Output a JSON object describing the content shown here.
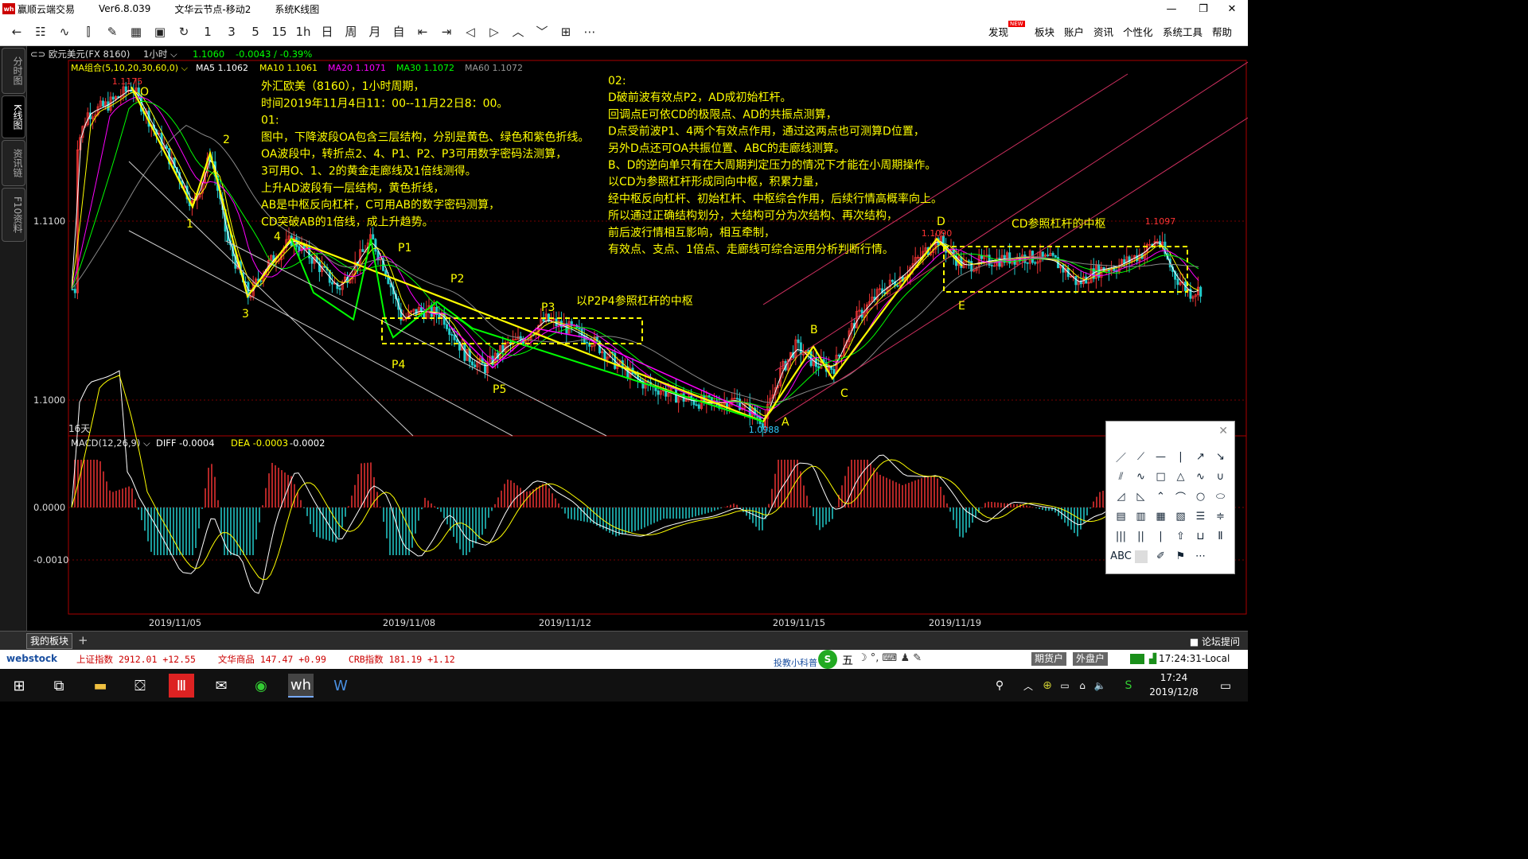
{
  "window": {
    "app": "赢顺云端交易",
    "version": "Ver6.8.039",
    "node": "文华云节点-移动2",
    "view": "系统K线图",
    "logo": "wh"
  },
  "toolbar": {
    "icons": [
      "back-icon",
      "table-icon",
      "line-chart-icon",
      "bar-icon",
      "draw-icon",
      "grid-icon",
      "save-icon",
      "refresh-icon"
    ],
    "periods": [
      "1",
      "3",
      "5",
      "15",
      "1h",
      "日",
      "周",
      "月",
      "自"
    ],
    "menu": [
      "发现",
      "板块",
      "账户",
      "资讯",
      "个性化",
      "系统工具",
      "帮助"
    ],
    "new_badge": "NEW"
  },
  "rail": [
    "分时图",
    "K线图",
    "资讯链",
    "F10资料"
  ],
  "chart": {
    "symbol": "欧元美元(FX 8160)",
    "period": "1小时",
    "last": "1.1060",
    "change": "-0.0043 / -0.39%",
    "ma_label": "MA组合(5,10,20,30,60,0)",
    "ma": [
      {
        "t": "MA5 1.1062",
        "c": "#ffffff"
      },
      {
        "t": "MA10 1.1061",
        "c": "#ffff00"
      },
      {
        "t": "MA20 1.1071",
        "c": "#ff00ff"
      },
      {
        "t": "MA30 1.1072",
        "c": "#00ff00"
      },
      {
        "t": "MA60 1.1072",
        "c": "#999999"
      }
    ],
    "yticks": [
      "1.1100",
      "1.1000"
    ],
    "high_label": "1.1175",
    "low_label": "1.0988",
    "d_label": "1.1090",
    "peak_label": "1.1097",
    "days": "16天",
    "macd_label": "MACD(12,26,9)",
    "diff": "DIFF -0.0004",
    "dea": "DEA -0.0003",
    "macd": "-0.0002",
    "macd_ticks": [
      "0.0000",
      "-0.0010"
    ],
    "dates": [
      "2019/11/05",
      "2019/11/08",
      "2019/11/12",
      "2019/11/15",
      "2019/11/19"
    ],
    "points": [
      "O",
      "1",
      "2",
      "3",
      "4",
      "P1",
      "P2",
      "P3",
      "P4",
      "P5",
      "A",
      "B",
      "C",
      "D",
      "E"
    ],
    "box1": "以P2P4参照杠杆的中枢",
    "box2": "CD参照杠杆的中枢",
    "note1": [
      "外汇欧美（8160），1小时周期，",
      "时间2019年11月4日11：00--11月22日8：00。",
      "01:",
      "图中，下降波段OA包含三层结构，分别是黄色、绿色和紫色折线。",
      "OA波段中，转折点2、4、P1、P2、P3可用数字密码法测算，",
      "3可用O、1、2的黄金走廊线及1倍线测得。",
      "上升AD波段有一层结构，黄色折线，",
      "AB是中枢反向杠杆，C可用AB的数字密码测算，",
      "CD突破AB的1倍线，成上升趋势。"
    ],
    "note2": [
      "02:",
      "D破前波有效点P2，AD成初始杠杆。",
      "回调点E可依CD的极限点、AD的共振点测算，",
      "D点受前波P1、4两个有效点作用，通过这两点也可测算D位置，",
      "另外D点还可OA共振位置、ABC的走廊线测算。",
      "B、D的逆向单只有在大周期判定压力的情况下才能在小周期操作。",
      "以CD为参照杠杆形成同向中枢，积累力量，",
      "经中枢反向杠杆、初始杠杆、中枢综合作用，后续行情高概率向上。",
      "所以通过正确结构划分，大结构可分为次结构、再次结构，",
      "前后波行情相互影响，相互牵制，",
      "有效点、支点、1倍点、走廊线可综合运用分析判断行情。"
    ]
  },
  "bottom": {
    "tab": "我的板块",
    "add": "+",
    "forum": "论坛提问"
  },
  "status": {
    "brand": "webstock",
    "idx": [
      {
        "n": "上证指数",
        "v": "2912.01",
        "c": "+12.55"
      },
      {
        "n": "文华商品",
        "v": "147.47",
        "c": "+0.99"
      },
      {
        "n": "CRB指数",
        "v": "181.19",
        "c": "+1.12"
      }
    ],
    "search": "投教小科普",
    "ime": "五",
    "futures": "期货户",
    "outer": "外盘户",
    "clock": "17:24:31-Local"
  },
  "taskbar": {
    "time": "17:24",
    "date": "2019/12/8"
  },
  "drawpanel": {
    "tools": [
      "line-tool-icon",
      "ray-tool-icon",
      "hline-tool-icon",
      "vline-tool-icon",
      "arrow-tool-icon",
      "vector-tool-icon",
      "parallel-tool-icon",
      "wave-tool-icon",
      "rect-tool-icon",
      "triangle-tool-icon",
      "wave2-tool-icon",
      "cup-tool-icon",
      "gann-tool-icon",
      "angle-tool-icon",
      "pitch-tool-icon",
      "arc-tool-icon",
      "circle-tool-icon",
      "ellipse-tool-icon",
      "fib-fan-icon",
      "fib2-icon",
      "fib-ret-icon",
      "fib-ext-icon",
      "fib-time-icon",
      "fib-channel-icon",
      "cycle-icon",
      "cycle2-icon",
      "cycle3-icon",
      "up-arrow-tool-icon",
      "ruler-tool-icon",
      "level-tool-icon",
      "text-tool-icon",
      "color-tool-icon",
      "eraser-tool-icon",
      "flag-tool-icon",
      "more-tools-icon"
    ],
    "abc": "ABC"
  }
}
